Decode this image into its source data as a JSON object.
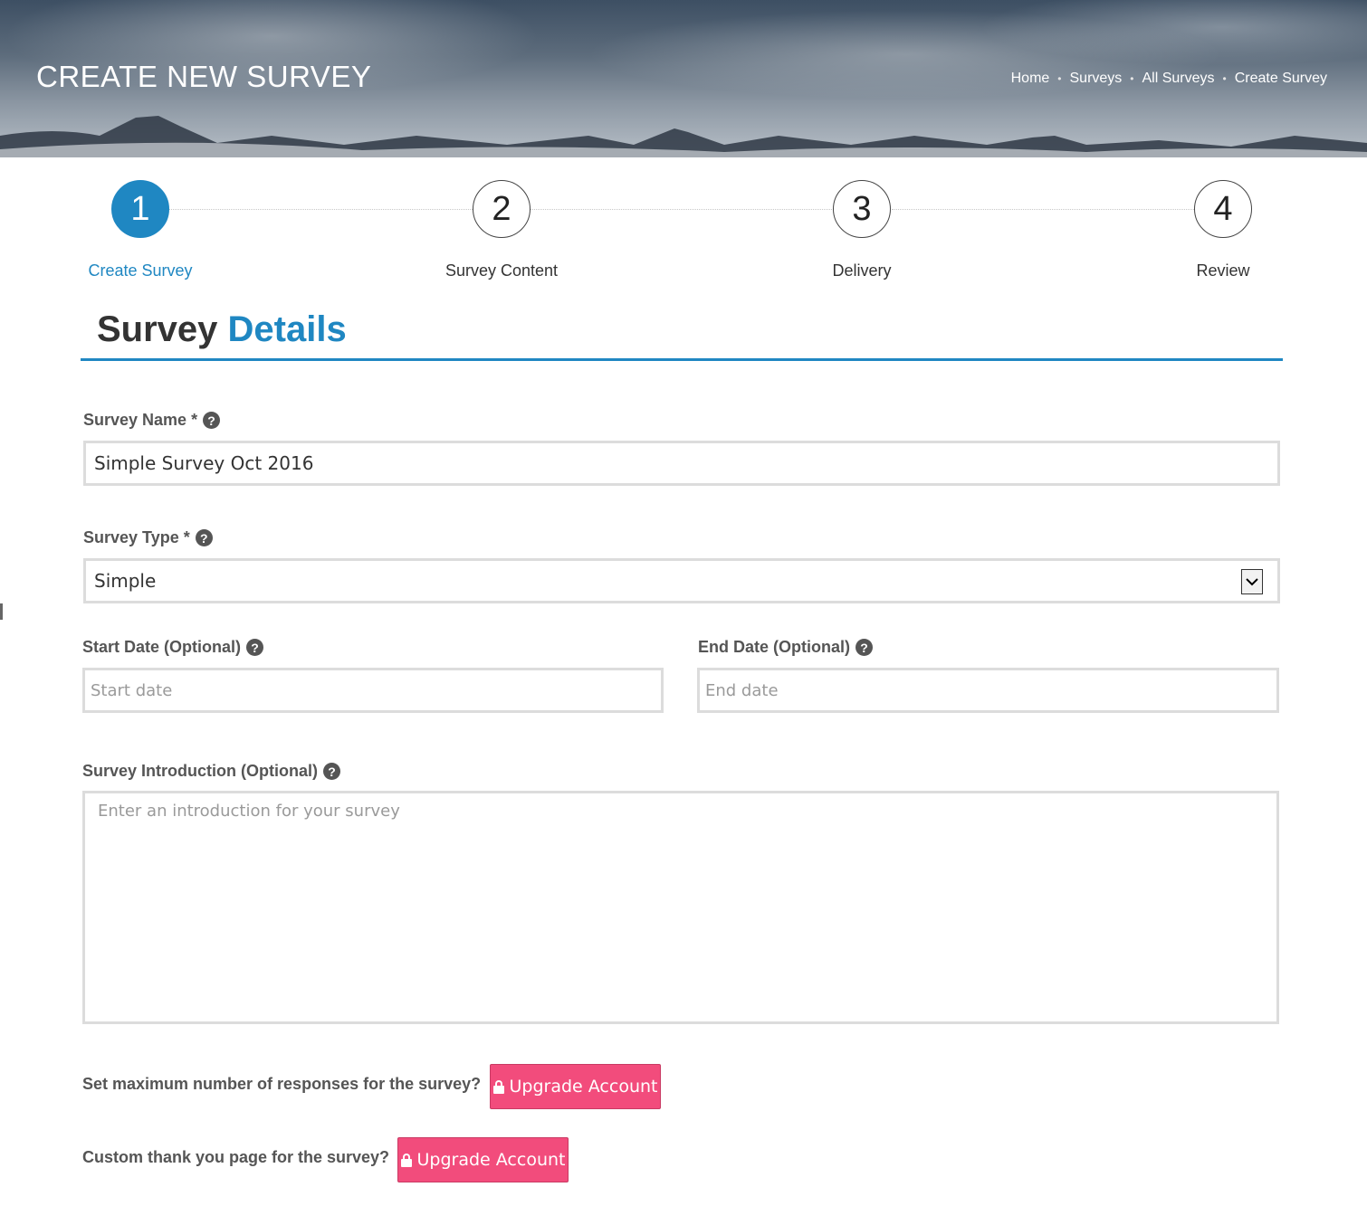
{
  "header": {
    "title": "CREATE NEW SURVEY",
    "breadcrumb": [
      "Home",
      "Surveys",
      "All Surveys",
      "Create Survey"
    ]
  },
  "stepper": {
    "steps": [
      {
        "number": "1",
        "label": "Create Survey",
        "active": true
      },
      {
        "number": "2",
        "label": "Survey Content",
        "active": false
      },
      {
        "number": "3",
        "label": "Delivery",
        "active": false
      },
      {
        "number": "4",
        "label": "Review",
        "active": false
      }
    ]
  },
  "section": {
    "title_part1": "Survey",
    "title_part2": "Details"
  },
  "form": {
    "survey_name": {
      "label": "Survey Name *",
      "value": "Simple Survey Oct 2016"
    },
    "survey_type": {
      "label": "Survey Type *",
      "value": "Simple"
    },
    "start_date": {
      "label": "Start Date (Optional)",
      "placeholder": "Start date"
    },
    "end_date": {
      "label": "End Date (Optional)",
      "placeholder": "End date"
    },
    "introduction": {
      "label": "Survey Introduction (Optional)",
      "placeholder": "Enter an introduction for your survey"
    },
    "max_responses": {
      "label": "Set maximum number of responses for the survey?",
      "button": "Upgrade Account"
    },
    "thank_you": {
      "label": "Custom thank you page for the survey?",
      "button": "Upgrade Account"
    }
  },
  "colors": {
    "accent": "#1f87c2",
    "upgrade": "#f24c7c"
  },
  "icons": {
    "help": "question-circle-icon",
    "lock": "lock-icon",
    "dropdown": "chevron-down-icon"
  }
}
